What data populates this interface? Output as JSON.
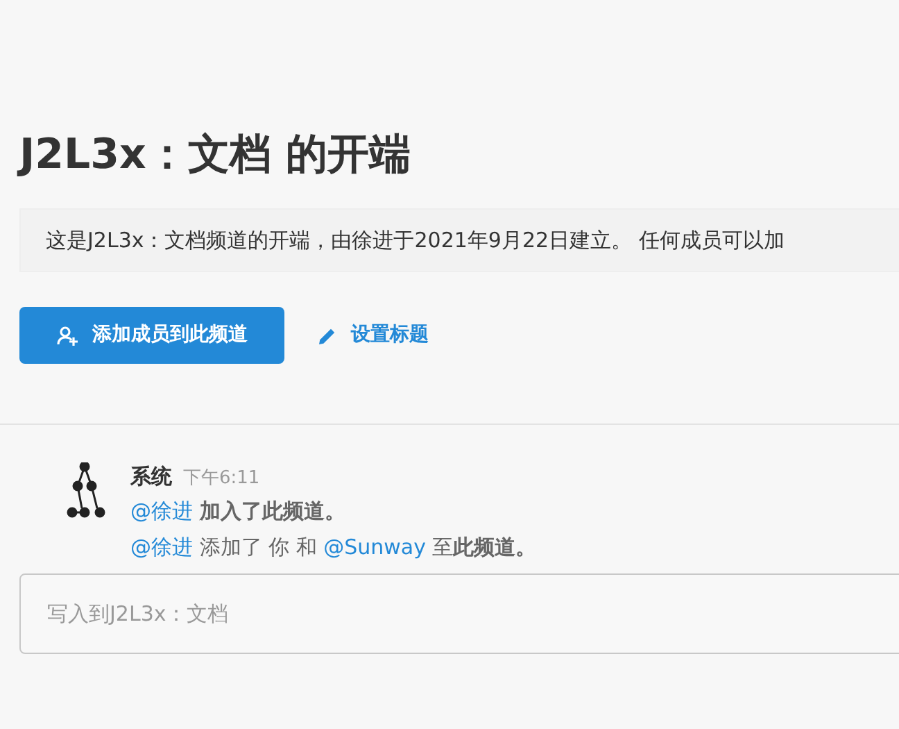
{
  "channel_title": "J2L3x：文档 的开端",
  "intro": "这是J2L3x：文档频道的开端，由徐进于2021年9月22日建立。 任何成员可以加",
  "actions": [
    {
      "kind": "primary",
      "label": "添加成员到此频道"
    },
    {
      "kind": "link",
      "label": "设置标题"
    }
  ],
  "message": {
    "author": "系统",
    "time": "下午6:11",
    "lines": [
      [
        {
          "kind": "mention",
          "text": "@徐进"
        },
        {
          "kind": "text",
          "text": " **加入了此频道。**"
        }
      ],
      [
        {
          "kind": "mention",
          "text": "@徐进"
        },
        {
          "kind": "text",
          "text": " 添加了 你 和 "
        },
        {
          "kind": "mention",
          "text": "@Sunway"
        },
        {
          "kind": "text",
          "text": " 至**此频道。**"
        }
      ]
    ]
  },
  "composer": {
    "placeholder": "写入到J2L3x：文档"
  }
}
